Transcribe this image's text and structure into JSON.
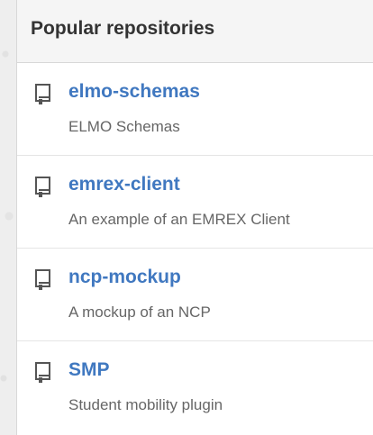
{
  "panel": {
    "title": "Popular repositories"
  },
  "repos": [
    {
      "name": "elmo-schemas",
      "description": "ELMO Schemas",
      "icon": "repo-book-icon"
    },
    {
      "name": "emrex-client",
      "description": "An example of an EMREX Client",
      "icon": "repo-book-icon"
    },
    {
      "name": "ncp-mockup",
      "description": "A mockup of an NCP",
      "icon": "repo-book-icon"
    },
    {
      "name": "SMP",
      "description": "Student mobility plugin",
      "icon": "repo-book-icon"
    }
  ],
  "colors": {
    "link": "#4078c0",
    "text_muted": "#666666",
    "title": "#333333",
    "header_bg": "#f5f5f5",
    "border": "#d8d8d8"
  }
}
